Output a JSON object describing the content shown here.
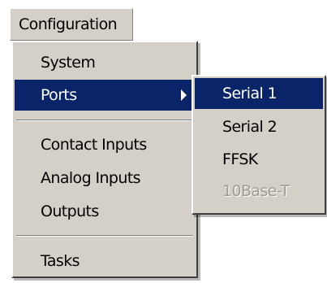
{
  "menubar": {
    "configuration_label": "Configuration"
  },
  "menu": {
    "items": [
      {
        "label": "System"
      },
      {
        "label": "Ports",
        "has_submenu": true,
        "selected": true
      },
      {
        "label": "Contact Inputs"
      },
      {
        "label": "Analog Inputs"
      },
      {
        "label": "Outputs"
      },
      {
        "label": "Tasks"
      }
    ]
  },
  "submenu": {
    "items": [
      {
        "label": "Serial 1",
        "selected": true
      },
      {
        "label": "Serial 2"
      },
      {
        "label": "FFSK"
      },
      {
        "label": "10Base-T",
        "disabled": true
      }
    ]
  },
  "colors": {
    "menu_bg": "#d4d0c8",
    "highlight": "#0a246a",
    "highlight_text": "#ffffff",
    "disabled_text": "#a09c94"
  }
}
